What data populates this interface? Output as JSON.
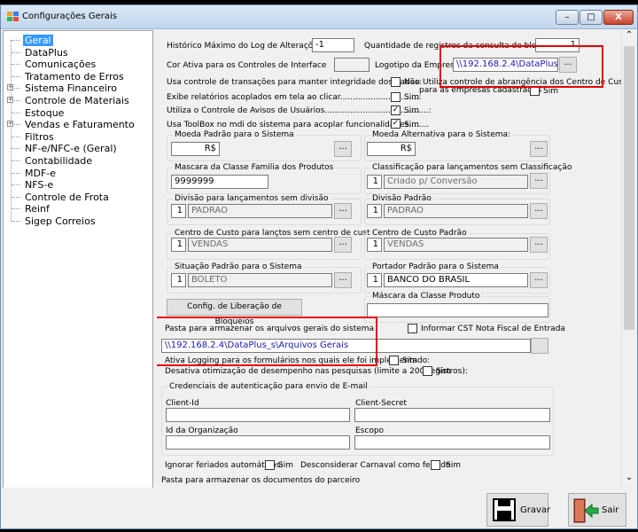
{
  "window": {
    "title": "Configurações Gerais",
    "min_icon": "–",
    "max_icon": "□",
    "close_icon": "X"
  },
  "tree": {
    "items": [
      {
        "label": "Geral",
        "selected": true,
        "expandable": false
      },
      {
        "label": "DataPlus",
        "expandable": false
      },
      {
        "label": "Comunicações",
        "expandable": false
      },
      {
        "label": "Tratamento de Erros",
        "expandable": false
      },
      {
        "label": "Sistema Financeiro",
        "expandable": true
      },
      {
        "label": "Controle de Materiais",
        "expandable": true
      },
      {
        "label": "Estoque",
        "expandable": false
      },
      {
        "label": "Vendas e Faturamento",
        "expandable": true
      },
      {
        "label": "Filtros",
        "expandable": false
      },
      {
        "label": "NF-e/NFC-e (Geral)",
        "expandable": false
      },
      {
        "label": "Contabilidade",
        "expandable": false
      },
      {
        "label": "MDF-e",
        "expandable": false
      },
      {
        "label": "NFS-e",
        "expandable": false
      },
      {
        "label": "Controle de Frota",
        "expandable": false
      },
      {
        "label": "Reinf",
        "expandable": false
      },
      {
        "label": "Sigep Correios",
        "expandable": false
      }
    ],
    "plus_glyph": "+"
  },
  "form": {
    "historico_label": "Histórico Máximo do Log de Alterações:",
    "historico_value": "-1",
    "qtd_registros_label": "Quantidade de registros da consulta de bloqueio:",
    "qtd_registros_value": "1",
    "cor_ativa_label": "Cor Ativa para os Controles de Interface",
    "logotipo_label": "Logotipo da Empresa:",
    "logotipo_value": "\\\\192.168.2.4\\DataPlus_",
    "ellipsis": "...",
    "usa_transacoes_label": "Usa controle de transações para manter integridade dos dados:",
    "usa_transacoes_value": "Não",
    "utiliza_abrangencia_label_1": "Utiliza controle de abrangência dos Centro de Custo",
    "utiliza_abrangencia_label_2": "para as empresas cadastradas",
    "utiliza_abrangencia_value": "Sim",
    "exibe_relatorios_label": "Exibe relatórios acoplados em tela ao clicar...............................:",
    "exibe_relatorios_value": "Sim",
    "avisos_label": "Utiliza o Controle de Avisos de Usuários.........................................:",
    "avisos_value": "Sim",
    "toolbox_label": "Usa ToolBox no mdi do sistema para acoplar funcionalidades........",
    "toolbox_value": "Sim",
    "moeda_padrao_title": "Moeda Padrão para o Sistema",
    "moeda_padrao_value": "R$",
    "moeda_alt_title": "Moeda Alternativa para o Sistema:",
    "moeda_alt_value": "R$",
    "mascara_familia_title": "Mascara da Classe Familia dos Produtos",
    "mascara_familia_value": "9999999",
    "classif_title": "Classificação para lançamentos sem Classificação",
    "classif_code": "1",
    "classif_value": "Criado p/ Conversão",
    "divisao_sem_title": "Divisão para lançamentos sem divisão",
    "divisao_sem_code": "1",
    "divisao_sem_value": "PADRAO",
    "divisao_padrao_title": "Divisão Padrão",
    "divisao_padrao_code": "1",
    "divisao_padrao_value": "PADRAO",
    "cc_sem_title": "Centro de Custo para lançtos sem centro de custo",
    "cc_sem_code": "1",
    "cc_sem_value": "VENDAS",
    "cc_padrao_title": "Centro de Custo Padrão",
    "cc_padrao_code": "1",
    "cc_padrao_value": "VENDAS",
    "situacao_title": "Situação Padrão para o Sistema",
    "situacao_code": "1",
    "situacao_value": "BOLETO",
    "portador_title": "Portador Padrão para o Sistema",
    "portador_code": "1",
    "portador_value": "BANCO DO BRASIL",
    "mascara_produto_title": "Máscara da Classe Produto",
    "config_bloqueios_label": "Config. de Liberação de Bloqueios",
    "pasta_label": "Pasta para armazenar os arquivos gerais do sistema",
    "informar_cst_label": "Informar CST Nota Fiscal de Entrada",
    "pasta_value": "\\\\192.168.2.4\\DataPlus_s\\Arquivos Gerais",
    "ativa_logging_label": "Ativa Logging para os formulários nos quais ele foi implementado:",
    "ativa_logging_value": "Sim",
    "desativa_otim_label": "Desativa otimização de desempenho nas pesquisas (limite a 200 registros):",
    "desativa_otim_value": "Sim",
    "credenciais_title": "Credenciais de autenticação para envio de E-mail",
    "client_id_label": "Client-Id",
    "client_secret_label": "Client-Secret",
    "id_org_label": "Id da Organização",
    "escopo_label": "Escopo",
    "ignorar_feriados_label": "Ignorar feriados automáticos:",
    "ignorar_feriados_value": "Sim",
    "carnaval_label": "Desconsiderar Carnaval como feriado:",
    "carnaval_value": "Sim",
    "pasta_parceiro_label": "Pasta para armazenar os documentos do parceiro",
    "check_mark": "✓"
  },
  "footer": {
    "gravar_label": "Gravar",
    "sair_label": "Sair"
  },
  "scroll": {
    "up": "⌃",
    "down": "⌄"
  }
}
